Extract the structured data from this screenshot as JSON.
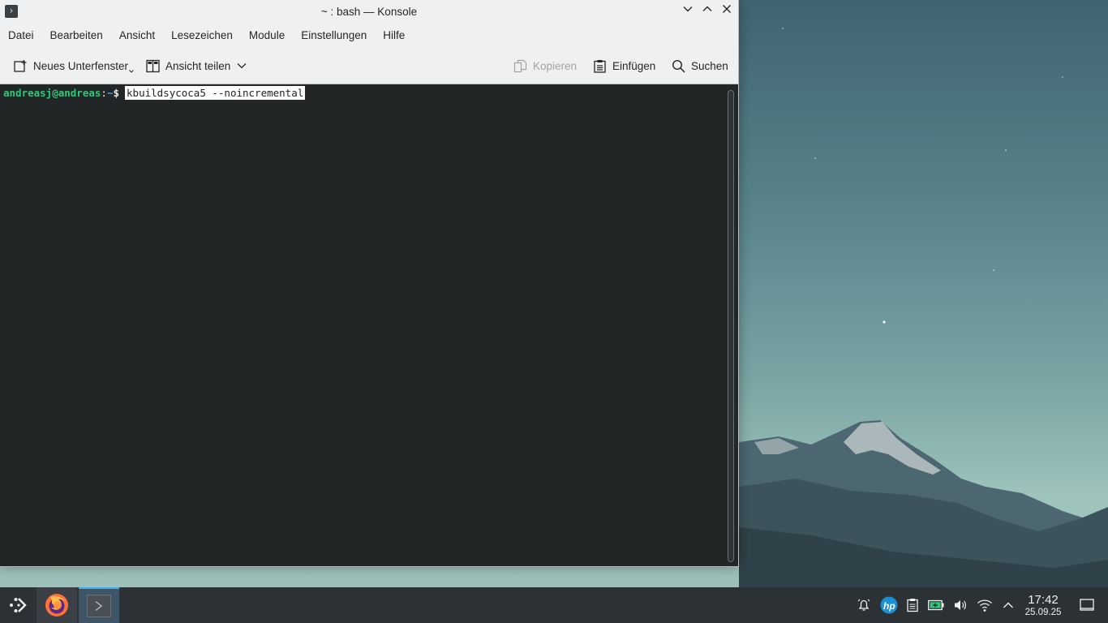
{
  "window": {
    "title": "~ : bash — Konsole",
    "controls": {
      "minimize": "⌄",
      "maximize": "⌃",
      "close": "✕"
    }
  },
  "menubar": {
    "items": [
      "Datei",
      "Bearbeiten",
      "Ansicht",
      "Lesezeichen",
      "Module",
      "Einstellungen",
      "Hilfe"
    ]
  },
  "toolbar": {
    "new_tab": "Neues Unterfenster",
    "split_view": "Ansicht teilen",
    "copy": "Kopieren",
    "paste": "Einfügen",
    "find": "Suchen"
  },
  "terminal": {
    "user_host": "andreasj@andreas",
    "separator": ":",
    "path": "~",
    "dollar": "$",
    "command": "kbuildsycoca5 --noincremental"
  },
  "taskbar": {
    "tasks": [
      "firefox-icon",
      "konsole-icon"
    ],
    "tray": [
      "alarm-icon",
      "hp-icon",
      "clipboard-icon",
      "battery-icon",
      "volume-icon",
      "wifi-icon",
      "expand-tray-icon"
    ],
    "clock": {
      "time": "17:42",
      "date": "25.09.25"
    }
  },
  "colors": {
    "terminal_bg": "#232627",
    "prompt_user": "#2fc877",
    "prompt_path": "#3d9ef4",
    "taskbar_bg": "#2c3136",
    "accent": "#3daee9"
  }
}
